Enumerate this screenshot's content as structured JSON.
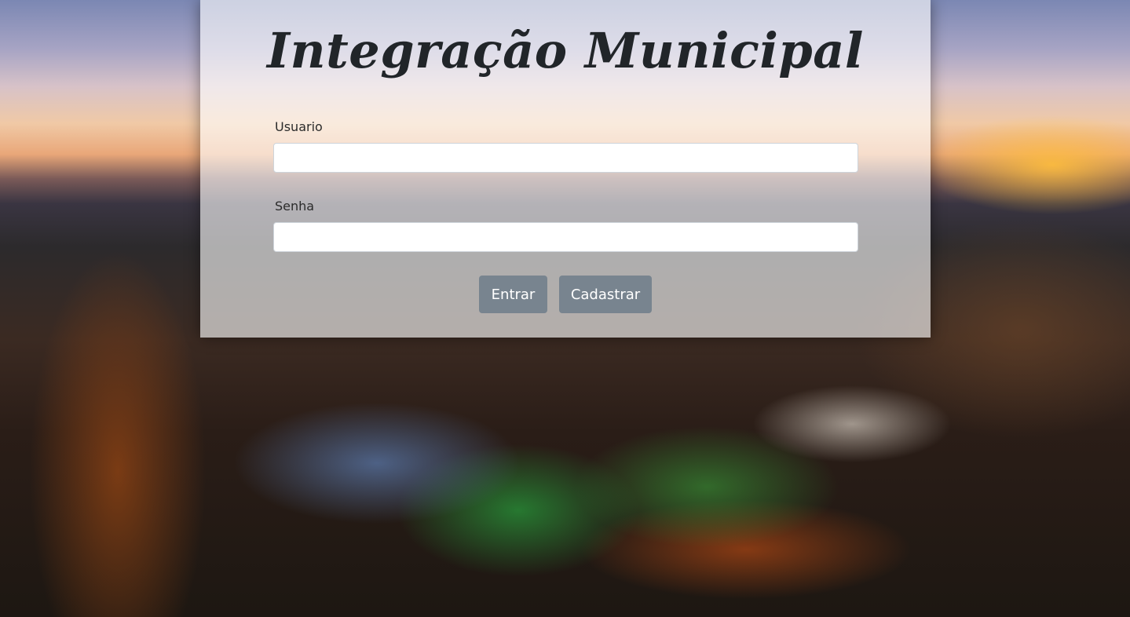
{
  "header": {
    "title": "Integração Municipal"
  },
  "form": {
    "usuario_label": "Usuario",
    "usuario_value": "",
    "senha_label": "Senha",
    "senha_value": ""
  },
  "actions": {
    "entrar_label": "Entrar",
    "cadastrar_label": "Cadastrar"
  },
  "colors": {
    "button_bg": "#78848f",
    "title_text": "#212529",
    "panel_overlay": "rgba(255,255,255,0.62)"
  }
}
